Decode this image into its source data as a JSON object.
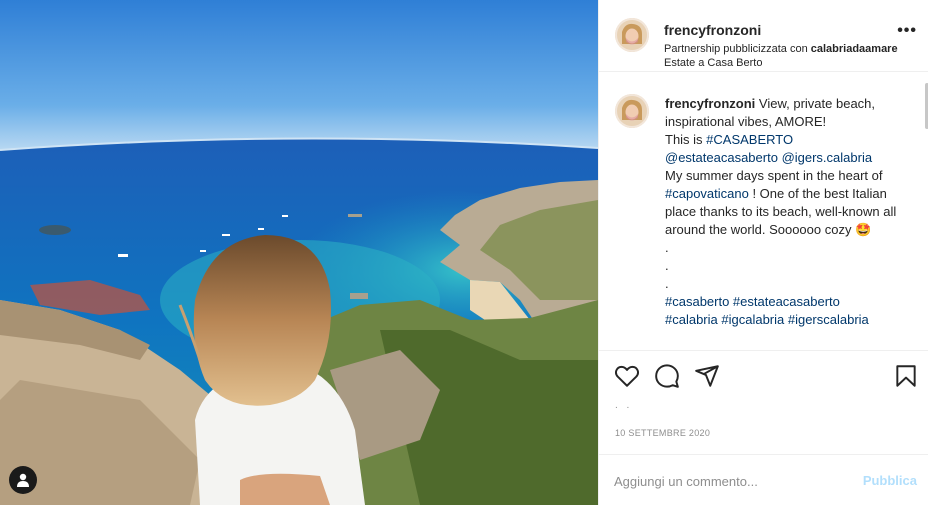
{
  "post": {
    "photo_alt_icon": "photo",
    "user_tag_icon": "user-silhouette-icon"
  },
  "header": {
    "username": "frencyfronzoni",
    "partnership_prefix": "Partnership pubblicizzata con ",
    "partner": "calabriadaamare",
    "location": "Estate a Casa Berto",
    "more_label": "•••"
  },
  "caption": {
    "username": "frencyfronzoni",
    "text_1": " View, private beach, inspirational vibes, AMORE!",
    "text_2": "This is ",
    "hashtag_casaberto": "#CASABERTO",
    "mention_1": "@estateacasaberto",
    "mention_2": "@igers.calabria",
    "text_3": "My summer days spent in the heart of ",
    "hashtag_capovaticano": "#capovaticano",
    "text_4": " ! One of the best Italian place thanks to its beach, well-known all around the world. Soooooo cozy ",
    "emoji": "🤩",
    "dots": ".\n.\n.",
    "hashtags_1": "#casaberto #estateacasaberto",
    "hashtags_2": "#calabria #igcalabria #igerscalabria"
  },
  "actions": {
    "like_icon": "heart-icon",
    "comment_icon": "comment-icon",
    "share_icon": "share-icon",
    "save_icon": "bookmark-icon"
  },
  "meta": {
    "likes_dots": ". .",
    "date": "10 SETTEMBRE 2020"
  },
  "comment_box": {
    "placeholder": "Aggiungi un commento...",
    "publish_label": "Pubblica"
  },
  "colors": {
    "link": "#00376b",
    "publish_disabled": "#b2dffc",
    "muted": "#8e8e8e",
    "border": "#efefef"
  }
}
